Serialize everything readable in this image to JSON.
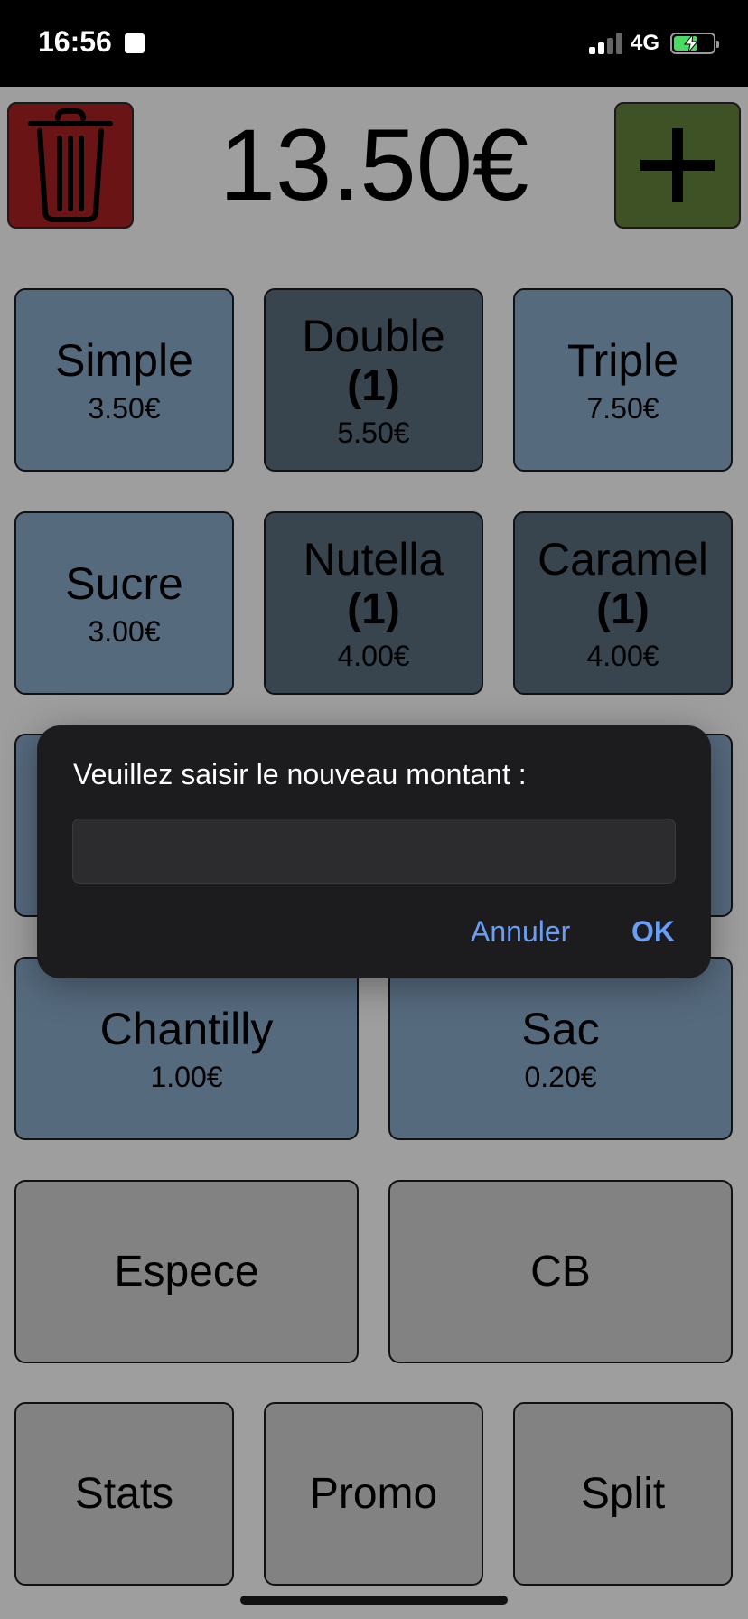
{
  "status_bar": {
    "time": "16:56",
    "network": "4G"
  },
  "header": {
    "total": "13.50€"
  },
  "products": [
    {
      "name": "Simple",
      "count": "",
      "price": "3.50€"
    },
    {
      "name": "Double",
      "count": "(1)",
      "price": "5.50€"
    },
    {
      "name": "Triple",
      "count": "",
      "price": "7.50€"
    },
    {
      "name": "Sucre",
      "count": "",
      "price": "3.00€"
    },
    {
      "name": "Nutella",
      "count": "(1)",
      "price": "4.00€"
    },
    {
      "name": "Caramel",
      "count": "(1)",
      "price": "4.00€"
    },
    {
      "name": "Chantilly",
      "count": "",
      "price": "1.00€"
    },
    {
      "name": "Sac",
      "count": "",
      "price": "0.20€"
    }
  ],
  "payments": {
    "cash": "Espece",
    "card": "CB"
  },
  "actions": {
    "stats": "Stats",
    "promo": "Promo",
    "split": "Split"
  },
  "dialog": {
    "message": "Veuillez saisir le nouveau montant :",
    "input_value": "",
    "cancel": "Annuler",
    "ok": "OK"
  },
  "colors": {
    "trash_bg": "#6a1416",
    "plus_bg": "#3e5226",
    "tile_default": "#566a7e",
    "tile_selected": "#38454f",
    "tile_grey": "#828282",
    "dialog_link": "#6a9ef5"
  }
}
